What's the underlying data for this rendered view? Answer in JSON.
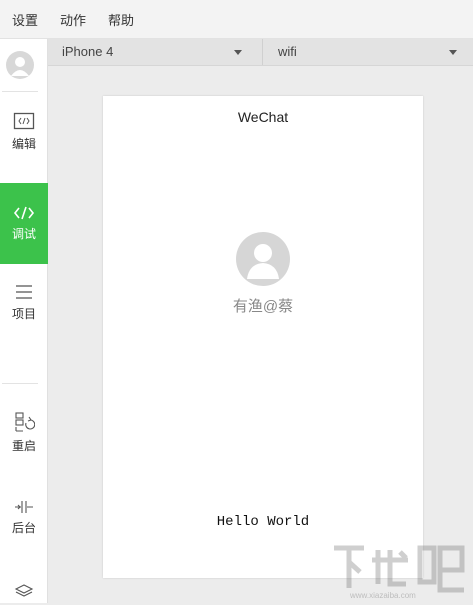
{
  "menubar": {
    "items": [
      "设置",
      "动作",
      "帮助"
    ]
  },
  "sidebar": {
    "avatar_icon": "user-avatar-icon",
    "items": [
      {
        "label": "编辑",
        "icon": "code-box-icon",
        "active": false
      },
      {
        "label": "调试",
        "icon": "code-icon",
        "active": true
      },
      {
        "label": "项目",
        "icon": "menu-lines-icon",
        "active": false
      },
      {
        "label": "重启",
        "icon": "restart-icon",
        "active": false
      },
      {
        "label": "后台",
        "icon": "background-icon",
        "active": false
      }
    ],
    "bottom_icon": "layers-icon"
  },
  "toolbar": {
    "device": "iPhone 4",
    "network": "wifi"
  },
  "phone": {
    "title": "WeChat",
    "nickname": "有渔@蔡",
    "hello": "Hello World"
  },
  "watermark": {
    "text": "下载吧",
    "url": "www.xiazaiba.com"
  },
  "colors": {
    "accent": "#3cc24b",
    "menubar": "#f3f3f3",
    "workspace": "#ececec"
  }
}
